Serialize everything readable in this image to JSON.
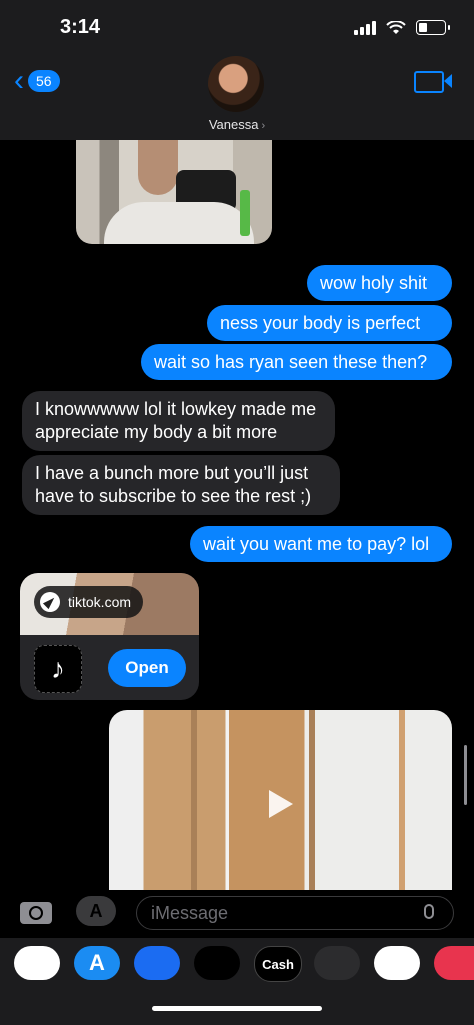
{
  "status": {
    "time": "3:14"
  },
  "header": {
    "back_count": "56",
    "contact_name": "Vanessa",
    "contact_chevron": "›"
  },
  "messages": [
    {
      "dir": "out",
      "text": "wow holy shit"
    },
    {
      "dir": "out",
      "text": "ness your body is perfect"
    },
    {
      "dir": "out",
      "text": "wait so has ryan seen these then?"
    },
    {
      "dir": "in",
      "lines": [
        "I knowwwww lol it lowkey made me",
        "appreciate my body a bit more"
      ]
    },
    {
      "dir": "in",
      "lines": [
        "I have a bunch more but you’ll just",
        "have to subscribe to see the rest ;)"
      ]
    },
    {
      "dir": "out",
      "text": "wait you want me to pay? lol"
    }
  ],
  "link_preview": {
    "domain": "tiktok.com",
    "open_label": "Open",
    "app_glyph": "♪"
  },
  "composer": {
    "placeholder": "iMessage"
  },
  "app_drawer": {
    "items": [
      {
        "name": "photos-app",
        "label": "",
        "bg": "#ffffff"
      },
      {
        "name": "app-store-app",
        "label": "A",
        "bg": "#1b8cf2"
      },
      {
        "name": "audio-message-app",
        "label": "",
        "bg": "#1b6cf2"
      },
      {
        "name": "fitness-app",
        "label": "",
        "bg": "#000000"
      },
      {
        "name": "apple-cash-app",
        "label": "Cash",
        "bg": "#000000"
      },
      {
        "name": "memoji-app",
        "label": "",
        "bg": "#2c2c2e"
      },
      {
        "name": "memoji-stickers-app",
        "label": "",
        "bg": "#ffffff"
      },
      {
        "name": "search-images-app",
        "label": "",
        "bg": "#e8344e"
      }
    ]
  },
  "colors": {
    "accent": "#0a84ff",
    "incoming_bubble": "#262629",
    "header_bg": "#1c1c1e"
  }
}
